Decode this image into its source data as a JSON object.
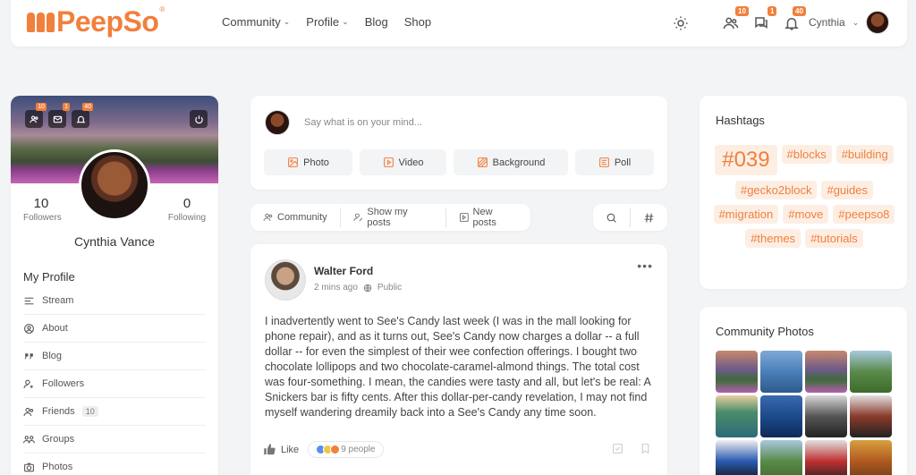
{
  "brand": {
    "name": "PeepSo",
    "reg": "®"
  },
  "nav": [
    {
      "label": "Community",
      "has_dropdown": true
    },
    {
      "label": "Profile",
      "has_dropdown": true
    },
    {
      "label": "Blog",
      "has_dropdown": false
    },
    {
      "label": "Shop",
      "has_dropdown": false
    }
  ],
  "top_badges": {
    "friends": "10",
    "messages": "1",
    "notifications": "40"
  },
  "user": {
    "name": "Cynthia"
  },
  "profile": {
    "full_name": "Cynthia Vance",
    "followers_count": "10",
    "followers_label": "Followers",
    "following_count": "0",
    "following_label": "Following",
    "cover_badges": {
      "friends": "10",
      "messages": "1",
      "notifications": "40"
    },
    "menu_title": "My Profile",
    "menu": [
      {
        "label": "Stream",
        "icon": "stream-icon"
      },
      {
        "label": "About",
        "icon": "user-circle-icon"
      },
      {
        "label": "Blog",
        "icon": "quote-icon"
      },
      {
        "label": "Followers",
        "icon": "user-plus-icon"
      },
      {
        "label": "Friends",
        "icon": "users-icon",
        "badge": "10"
      },
      {
        "label": "Groups",
        "icon": "groups-icon"
      },
      {
        "label": "Photos",
        "icon": "camera-icon"
      }
    ]
  },
  "composer": {
    "placeholder": "Say what is on your mind...",
    "buttons": [
      {
        "label": "Photo",
        "icon": "image-icon"
      },
      {
        "label": "Video",
        "icon": "video-icon"
      },
      {
        "label": "Background",
        "icon": "background-icon"
      },
      {
        "label": "Poll",
        "icon": "poll-icon"
      }
    ]
  },
  "filters": [
    {
      "label": "Community",
      "icon": "users-icon"
    },
    {
      "label": "Show my posts",
      "icon": "user-edit-icon"
    },
    {
      "label": "New posts",
      "icon": "new-posts-icon"
    }
  ],
  "post": {
    "author": "Walter Ford",
    "time": "2 mins ago",
    "privacy": "Public",
    "text": "I inadvertently went to See's Candy last week (I was in the mall looking for phone repair), and as it turns out, See's Candy now charges a dollar -- a full dollar -- for even the simplest of their wee confection offerings. I bought two chocolate lollipops and two chocolate-caramel-almond things. The total cost was four-something. I mean, the candies were tasty and all, but let's be real: A Snickers bar is fifty cents. After this dollar-per-candy revelation, I may not find myself wandering dreamily back into a See's Candy any time soon.",
    "like_label": "Like",
    "reactions_label": "9 people"
  },
  "hashtags": {
    "title": "Hashtags",
    "tags": [
      "#039",
      "#blocks",
      "#building",
      "#gecko2block",
      "#guides",
      "#migration",
      "#move",
      "#peepso8",
      "#themes",
      "#tutorials"
    ]
  },
  "community_photos": {
    "title": "Community Photos"
  },
  "colors": {
    "accent": "#f0803c",
    "accent_light": "#fdeee4",
    "background": "#f3f4f6"
  }
}
